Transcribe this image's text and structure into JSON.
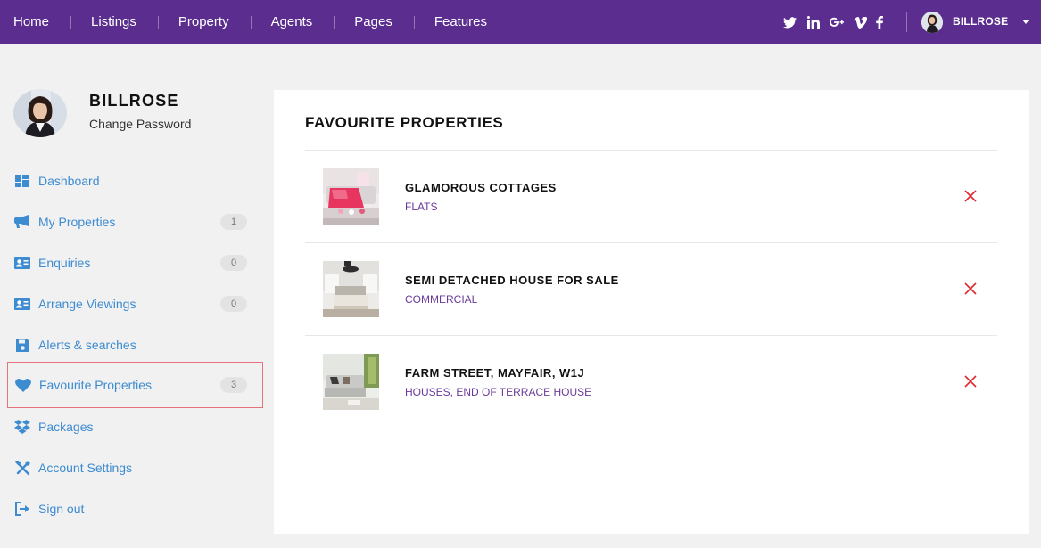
{
  "nav": {
    "items": [
      {
        "label": "Home"
      },
      {
        "label": "Listings"
      },
      {
        "label": "Property"
      },
      {
        "label": "Agents"
      },
      {
        "label": "Pages"
      },
      {
        "label": "Features"
      }
    ],
    "social_icons": [
      "twitter-icon",
      "linkedin-icon",
      "google-plus-icon",
      "vimeo-icon",
      "facebook-icon"
    ],
    "user_name": "BILLROSE"
  },
  "profile": {
    "name": "BILLROSE",
    "change_password": "Change Password"
  },
  "sidebar": {
    "items": [
      {
        "label": "Dashboard",
        "icon": "dashboard-icon",
        "badge": ""
      },
      {
        "label": "My Properties",
        "icon": "megaphone-icon",
        "badge": "1"
      },
      {
        "label": "Enquiries",
        "icon": "id-card-icon",
        "badge": "0"
      },
      {
        "label": "Arrange Viewings",
        "icon": "id-card-icon",
        "badge": "0"
      },
      {
        "label": "Alerts & searches",
        "icon": "save-icon",
        "badge": ""
      },
      {
        "label": "Favourite Properties",
        "icon": "heart-icon",
        "badge": "3",
        "active": true
      },
      {
        "label": "Packages",
        "icon": "dropbox-icon",
        "badge": ""
      },
      {
        "label": "Account Settings",
        "icon": "tools-icon",
        "badge": ""
      },
      {
        "label": "Sign out",
        "icon": "sign-out-icon",
        "badge": ""
      }
    ]
  },
  "main": {
    "title": "FAVOURITE PROPERTIES",
    "properties": [
      {
        "name": "GLAMOROUS COTTAGES",
        "type": "FLATS"
      },
      {
        "name": "SEMI DETACHED HOUSE FOR SALE",
        "type": "COMMERCIAL"
      },
      {
        "name": "FARM STREET, MAYFAIR, W1J",
        "type": "HOUSES, END OF TERRACE HOUSE"
      }
    ]
  },
  "colors": {
    "nav_bg": "#5b2d8e",
    "link": "#3d8bd1",
    "category": "#6a3a9a",
    "remove": "#e0282c",
    "active_border": "#e5737e"
  }
}
